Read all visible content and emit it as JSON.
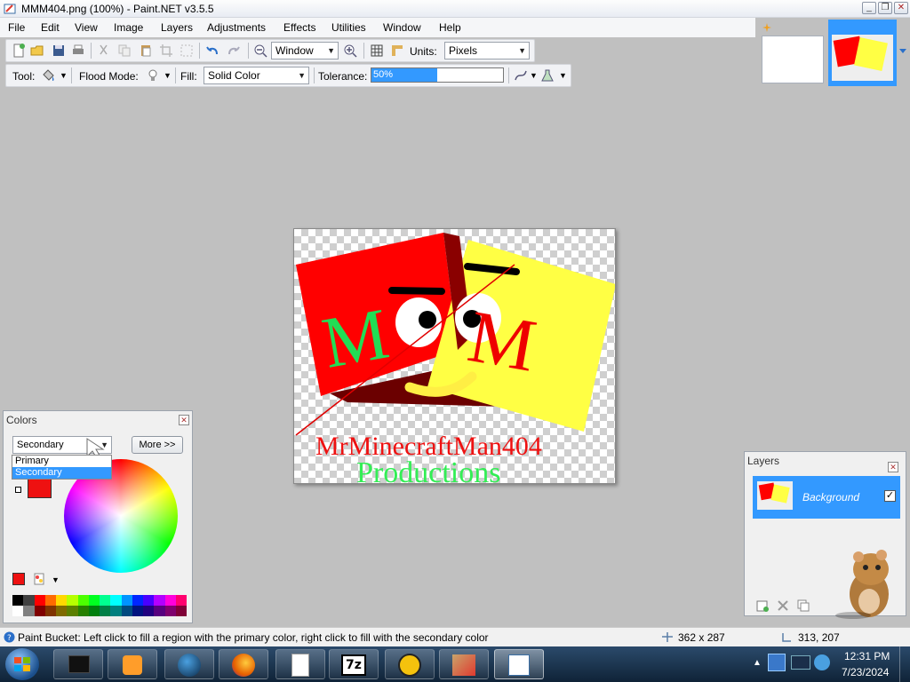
{
  "window": {
    "title": "MMM404.png (100%) - Paint.NET v3.5.5",
    "minimize": "_",
    "restore": "❐",
    "close": "✕"
  },
  "menu": [
    "File",
    "Edit",
    "View",
    "Image",
    "Layers",
    "Adjustments",
    "Effects",
    "Utilities",
    "Window",
    "Help"
  ],
  "toolbar": {
    "zoom_value": "Window",
    "units_label": "Units:",
    "units_value": "Pixels",
    "tool_label": "Tool:",
    "flood_mode_label": "Flood Mode:",
    "fill_label": "Fill:",
    "fill_value": "Solid Color",
    "tolerance_label": "Tolerance:",
    "tolerance_value": "50%",
    "tolerance_fraction": 0.5
  },
  "canvas_art": {
    "line1": "MrMinecraftMan404",
    "line2": "Productions",
    "letter_left": "M",
    "letter_right": "M"
  },
  "colors_panel": {
    "title": "Colors",
    "selected": "Secondary",
    "options": [
      "Primary",
      "Secondary"
    ],
    "more_button": "More >>",
    "primary_color": "#ee1111",
    "secondary_color": "#ee1111"
  },
  "layers_panel": {
    "title": "Layers",
    "layer_name": "Background",
    "visible_check": "✓"
  },
  "status": {
    "message": "Paint Bucket: Left click to fill a region with the primary color, right click to fill with the secondary color",
    "image_size": "362 x 287",
    "cursor_pos": "313, 207"
  },
  "taskbar": {
    "time": "12:31 PM",
    "date": "7/23/2024"
  },
  "colors": {
    "accent_blue": "#3399ff",
    "brand_red": "#ff0000",
    "brand_yellow": "#ffff44",
    "brand_green": "#33ee55"
  }
}
